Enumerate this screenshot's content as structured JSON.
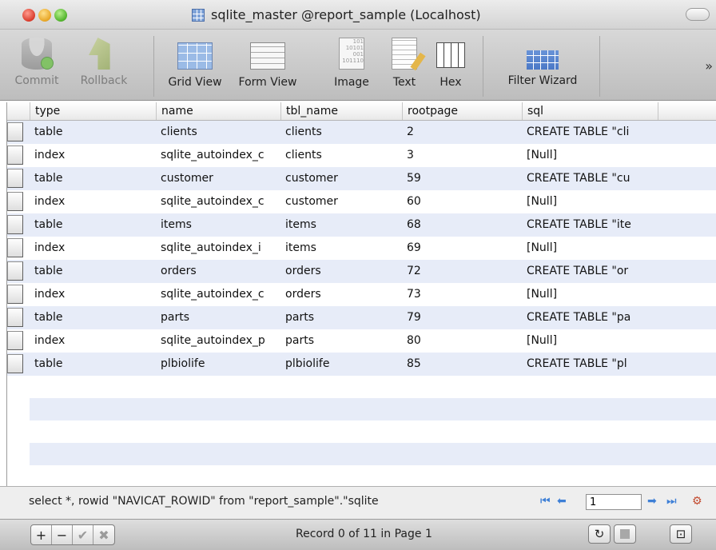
{
  "window": {
    "title": "sqlite_master @report_sample (Localhost)"
  },
  "toolbar": {
    "commit": "Commit",
    "rollback": "Rollback",
    "grid_view": "Grid View",
    "form_view": "Form View",
    "image": "Image",
    "text": "Text",
    "hex": "Hex",
    "filter_wizard": "Filter Wizard",
    "image_icon_text": "101\n10101\n001\n101110",
    "overflow": "»"
  },
  "grid": {
    "columns": [
      "type",
      "name",
      "tbl_name",
      "rootpage",
      "sql"
    ],
    "rows": [
      [
        "table",
        "clients",
        "clients",
        "2",
        "CREATE TABLE \"cli"
      ],
      [
        "index",
        "sqlite_autoindex_c",
        "clients",
        "3",
        "[Null]"
      ],
      [
        "table",
        "customer",
        "customer",
        "59",
        "CREATE TABLE \"cu"
      ],
      [
        "index",
        "sqlite_autoindex_c",
        "customer",
        "60",
        "[Null]"
      ],
      [
        "table",
        "items",
        "items",
        "68",
        "CREATE TABLE \"ite"
      ],
      [
        "index",
        "sqlite_autoindex_i",
        "items",
        "69",
        "[Null]"
      ],
      [
        "table",
        "orders",
        "orders",
        "72",
        "CREATE TABLE \"or"
      ],
      [
        "index",
        "sqlite_autoindex_c",
        "orders",
        "73",
        "[Null]"
      ],
      [
        "table",
        "parts",
        "parts",
        "79",
        "CREATE TABLE \"pa"
      ],
      [
        "index",
        "sqlite_autoindex_p",
        "parts",
        "80",
        "[Null]"
      ],
      [
        "table",
        "plbiolife",
        "plbiolife",
        "85",
        "CREATE TABLE \"pl"
      ]
    ]
  },
  "status": {
    "sql": "select *, rowid \"NAVICAT_ROWID\" from \"report_sample\".\"sqlite",
    "page": "1"
  },
  "bottom": {
    "add": "+",
    "remove": "−",
    "apply": "✔",
    "discard": "✖",
    "record_info": "Record 0 of 11 in Page 1",
    "refresh": "↻",
    "more": "⊡"
  }
}
